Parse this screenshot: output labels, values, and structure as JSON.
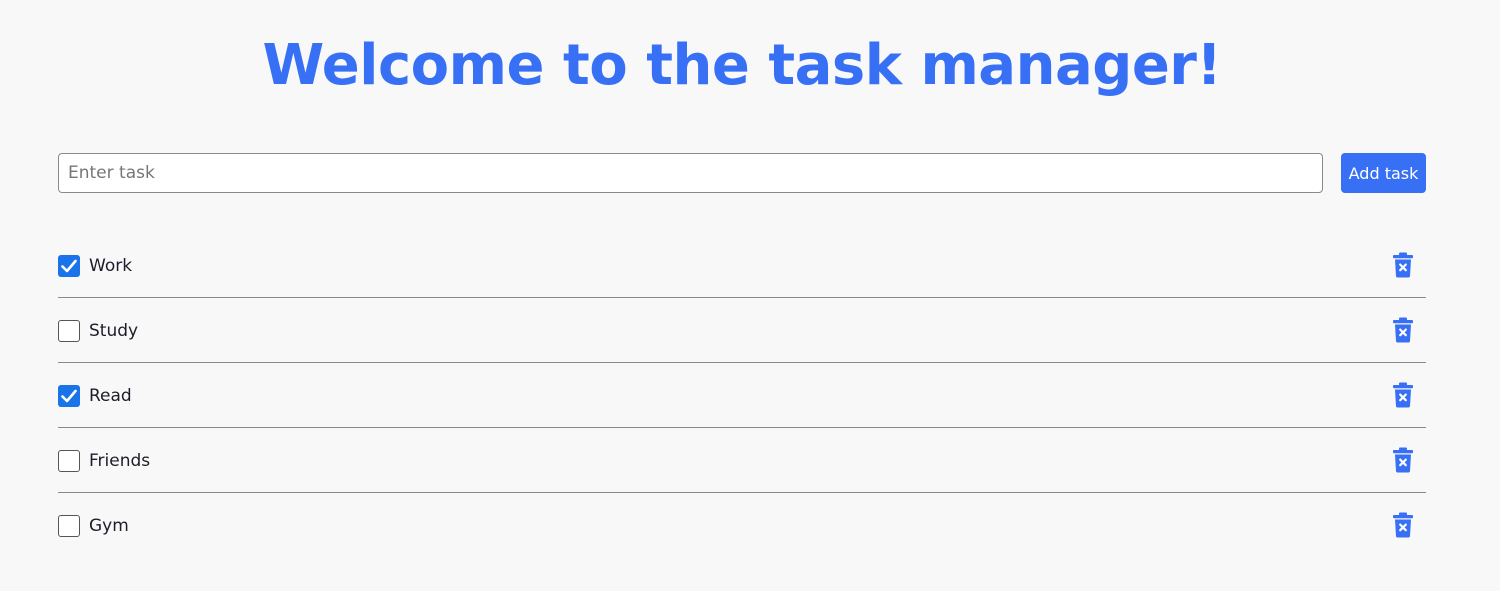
{
  "header": {
    "title": "Welcome to the task manager!"
  },
  "task_form": {
    "input_value": "",
    "input_placeholder": "Enter task",
    "add_button_label": "Add task"
  },
  "tasks": [
    {
      "label": "Work",
      "checked": true
    },
    {
      "label": "Study",
      "checked": false
    },
    {
      "label": "Read",
      "checked": true
    },
    {
      "label": "Friends",
      "checked": false
    },
    {
      "label": "Gym",
      "checked": false
    }
  ],
  "icons": {
    "delete": "trash-x-icon",
    "check": "checkmark-icon"
  },
  "colors": {
    "accent": "#3870f5",
    "checkbox_checked": "#1a73e8",
    "background": "#f8f8f9",
    "divider": "#8a8a8a"
  }
}
